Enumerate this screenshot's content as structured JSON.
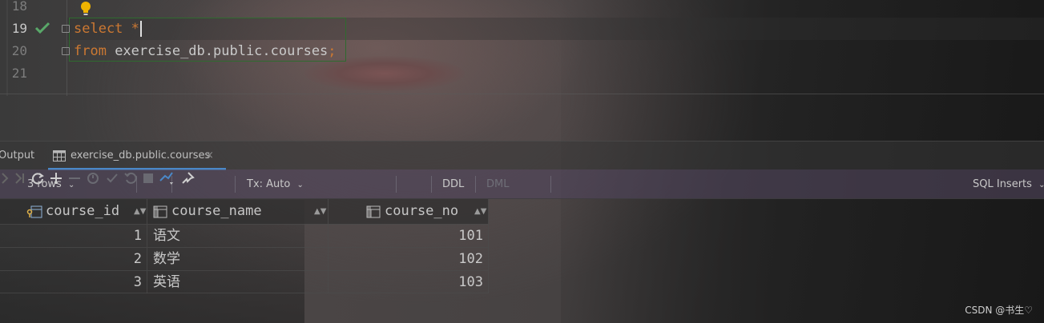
{
  "editor": {
    "lines": [
      {
        "num": "18",
        "keyword": "",
        "rest": ""
      },
      {
        "num": "19",
        "keyword": "select",
        "rest": " *"
      },
      {
        "num": "20",
        "keyword": "from",
        "rest": " exercise_db.public.courses",
        "semicolon": ";"
      },
      {
        "num": "21",
        "keyword": "",
        "rest": ""
      }
    ]
  },
  "tabs": {
    "output_label": "Output",
    "courses_label": "exercise_db.public.courses",
    "close_glyph": "×"
  },
  "toolbar": {
    "rows_label": "3 rows",
    "tx_label": "Tx: Auto",
    "ddl_label": "DDL",
    "dml_label": "DML",
    "sql_inserts_label": "SQL Inserts"
  },
  "grid": {
    "columns": [
      "course_id",
      "course_name",
      "course_no"
    ],
    "rows": [
      {
        "course_id": "1",
        "course_name": "语文",
        "course_no": "101"
      },
      {
        "course_id": "2",
        "course_name": "数学",
        "course_no": "102"
      },
      {
        "course_id": "3",
        "course_name": "英语",
        "course_no": "103"
      }
    ]
  },
  "watermark": "CSDN @书生♡",
  "colors": {
    "keyword": "#cc7832",
    "check": "#59a869",
    "tab_underline": "#4a88c7",
    "bulb": "#f0b400"
  }
}
